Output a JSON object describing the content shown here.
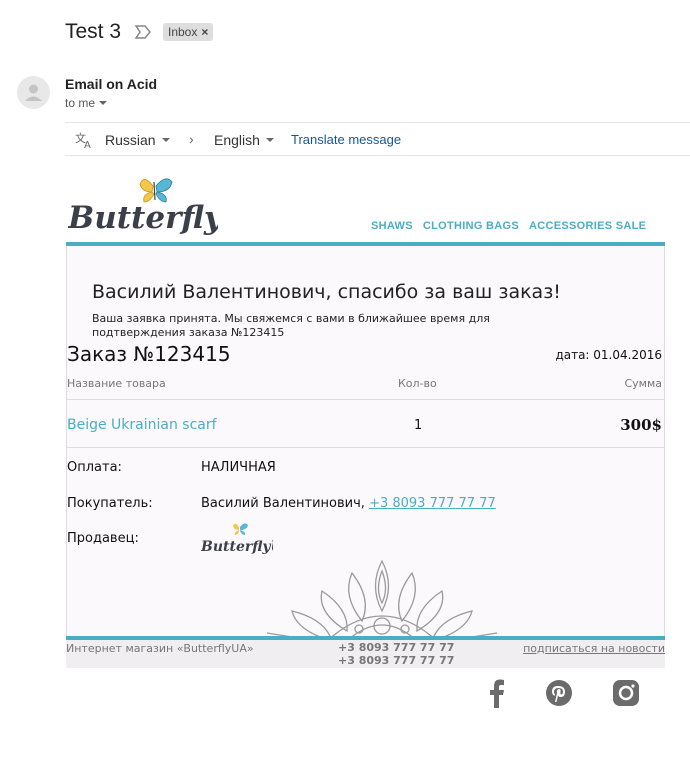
{
  "header": {
    "subject": "Test 3",
    "label": "Inbox",
    "label_close": "×"
  },
  "message": {
    "sender": "Email on Acid",
    "to": "to me"
  },
  "translate": {
    "from": "Russian",
    "to": "English",
    "link": "Translate message"
  },
  "email": {
    "brand": "ButterflyUA",
    "nav": [
      "SHAWS",
      "CLOTHING BAGS",
      "ACCESSORIES SALE"
    ],
    "thanks": "Василий Валентинович, спасибо за ваш заказ!",
    "note": "Ваша заявка принята. Мы свяжемся с вами в ближайшее время для подтверждения заказа №123415",
    "order_title": "Заказ №123415",
    "order_date": "дата: 01.04.2016",
    "columns": {
      "name": "Название товара",
      "qty": "Кол-во",
      "sum": "Сумма"
    },
    "item": {
      "name": "Beige Ukrainian scarf",
      "qty": "1",
      "sum": "300$"
    },
    "payment_label": "Оплата:",
    "payment_value": "НАЛИЧНАЯ",
    "buyer_label": "Покупатель:",
    "buyer_name": "Василий Валентинович,",
    "buyer_phone": "+3 8093 777 77 77",
    "seller_label": "Продавец:",
    "footer": {
      "shop": "Интернет магазин «ButterflyUA»",
      "phone1": "+3 8093 777 77 77",
      "phone2": "+3 8093 777 77 77",
      "subscribe": "подписаться на новости"
    }
  },
  "social": [
    "facebook-icon",
    "pinterest-icon",
    "instagram-icon"
  ],
  "colors": {
    "accent": "#4aadc4",
    "link": "#15569b"
  }
}
